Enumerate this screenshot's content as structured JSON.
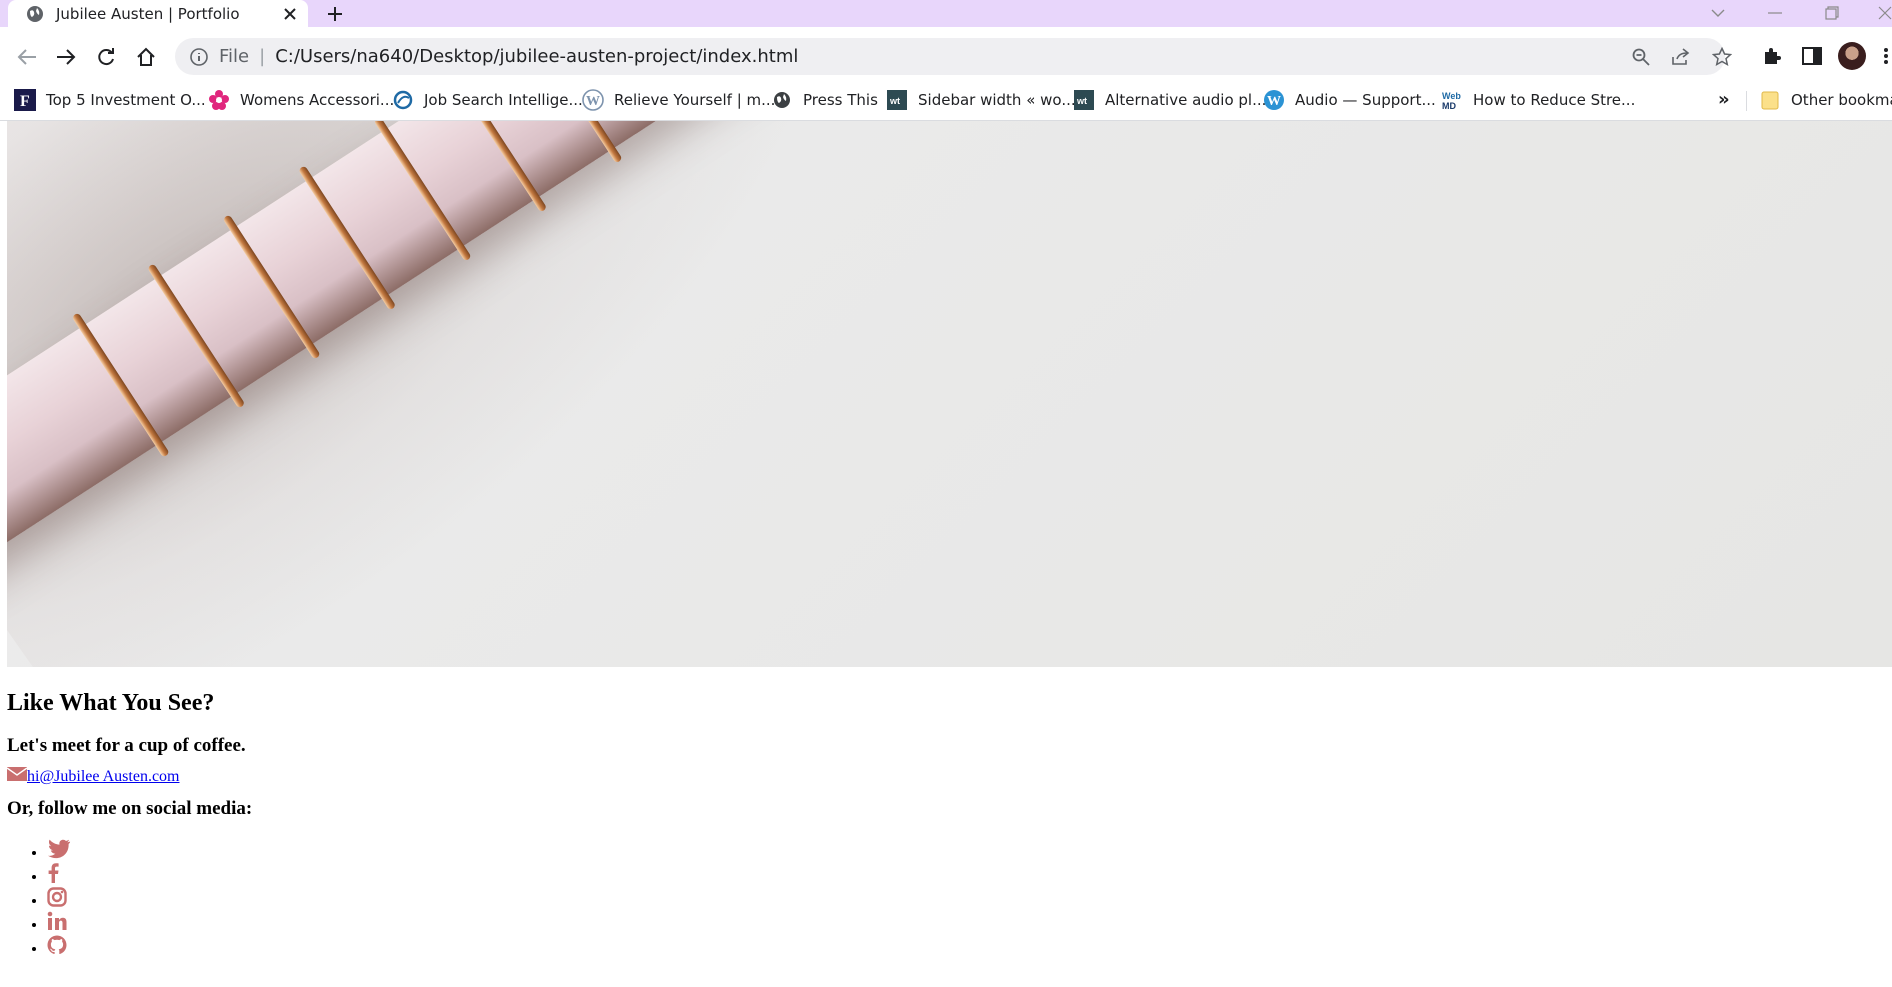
{
  "browser": {
    "tab_title": "Jubilee Austen | Portfolio",
    "address_scheme": "File",
    "address_url": "C:/Users/na640/Desktop/jubilee-austen-project/index.html",
    "bookmarks": [
      {
        "label": "Top 5 Investment O...",
        "icon": "forbes-icon"
      },
      {
        "label": "Womens Accessori...",
        "icon": "flower-icon"
      },
      {
        "label": "Job Search Intellige...",
        "icon": "job-search-icon"
      },
      {
        "label": "Relieve Yourself | m...",
        "icon": "wordpress-icon"
      },
      {
        "label": "Press This",
        "icon": "globe-icon"
      },
      {
        "label": "Sidebar width « wo...",
        "icon": "wt-icon"
      },
      {
        "label": "Alternative audio pl...",
        "icon": "wt-icon"
      },
      {
        "label": "Audio — Support...",
        "icon": "wordpress-icon"
      },
      {
        "label": "How to Reduce Stre...",
        "icon": "webmd-icon"
      }
    ],
    "bookmarks_more": "»",
    "other_bookmarks": "Other bookmarks"
  },
  "page": {
    "heading": "Like What You See?",
    "subheading": "Let's meet for a cup of coffee.",
    "email": "hi@Jubilee Austen.com",
    "social_heading": "Or, follow me on social media:",
    "social_links": [
      "twitter",
      "facebook",
      "instagram",
      "linkedin",
      "github"
    ]
  },
  "colors": {
    "tab_strip": "#e8d6fb",
    "icon_accent": "#c96f6f",
    "link": "#0000ee"
  }
}
